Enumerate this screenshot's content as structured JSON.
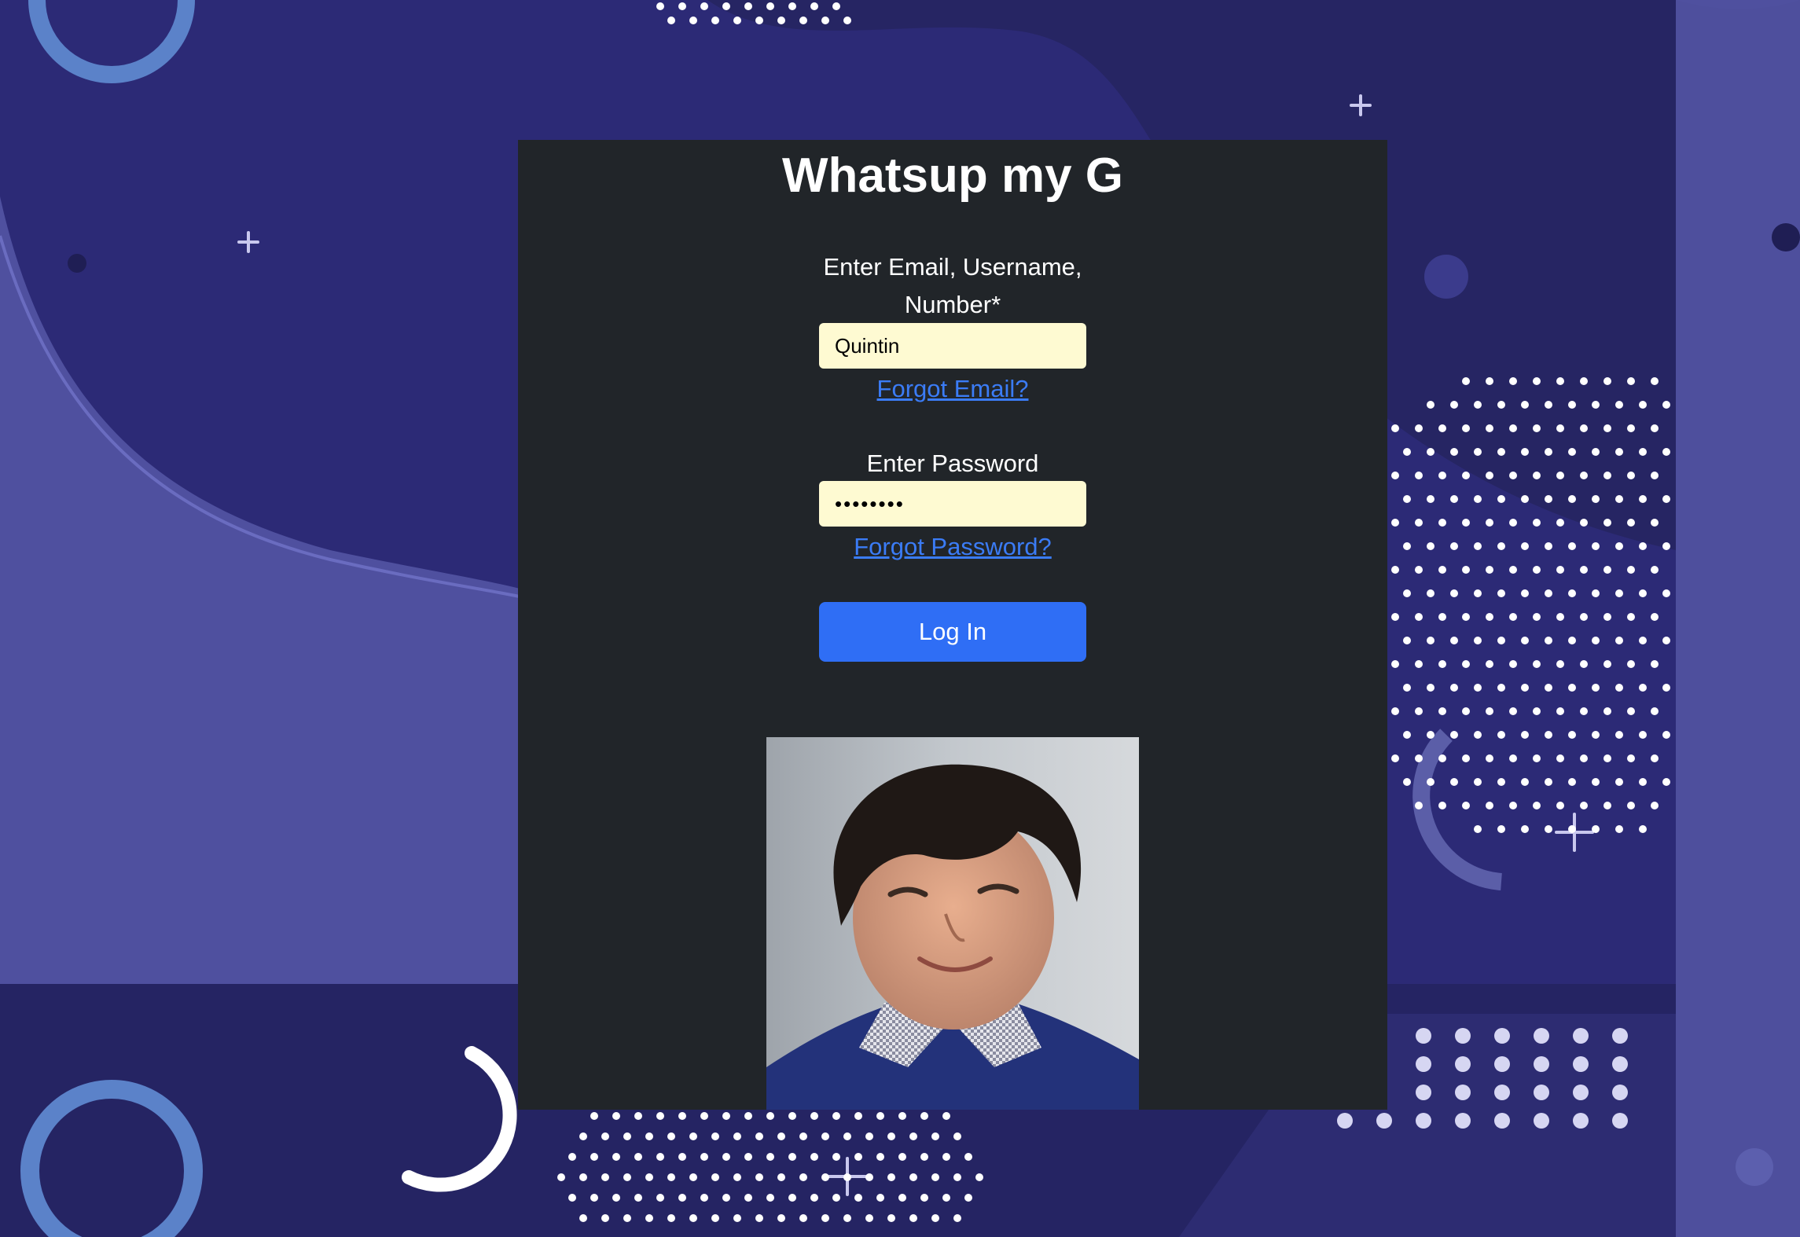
{
  "page": {
    "title": "Whatsup my G"
  },
  "login_form": {
    "email_label": "Enter Email, Username, Number*",
    "email_value": "Quintin",
    "forgot_email_link": "Forgot Email?",
    "password_label": "Enter Password",
    "password_value": "••••••••",
    "forgot_password_link": "Forgot Password?",
    "login_button": "Log In"
  },
  "colors": {
    "background": "#2c2a76",
    "card": "#212529",
    "input_fill": "#fefad2",
    "link": "#3b7cf6",
    "button": "#2f6ef5"
  },
  "icons": [
    "plus-icon",
    "circle-ring-icon",
    "dot-pattern"
  ]
}
